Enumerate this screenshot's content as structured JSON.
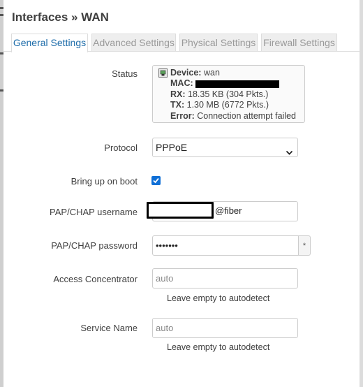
{
  "page": {
    "title": "Interfaces » WAN"
  },
  "tabs": [
    {
      "label": "General Settings",
      "active": true
    },
    {
      "label": "Advanced Settings",
      "active": false
    },
    {
      "label": "Physical Settings",
      "active": false
    },
    {
      "label": "Firewall Settings",
      "active": false
    }
  ],
  "status": {
    "label": "Status",
    "icon": "ethernet-port-icon",
    "device_key": "Device:",
    "device_value": "wan",
    "mac_key": "MAC:",
    "rx_key": "RX:",
    "rx_value": "18.35 KB (304 Pkts.)",
    "tx_key": "TX:",
    "tx_value": "1.30 MB (6772 Pkts.)",
    "error_key": "Error:",
    "error_value": "Connection attempt failed"
  },
  "protocol": {
    "label": "Protocol",
    "value": "PPPoE"
  },
  "boot": {
    "label": "Bring up on boot",
    "checked": true
  },
  "username": {
    "label": "PAP/CHAP username",
    "suffix": "@fiber"
  },
  "password": {
    "label": "PAP/CHAP password",
    "value": "•••••••",
    "reveal_symbol": "*"
  },
  "concentrator": {
    "label": "Access Concentrator",
    "placeholder": "auto",
    "hint": "Leave empty to autodetect"
  },
  "service": {
    "label": "Service Name",
    "placeholder": "auto",
    "hint": "Leave empty to autodetect"
  },
  "colors": {
    "accent": "#1a6aa8",
    "checkbox": "#0f6fd6",
    "text": "#404040"
  }
}
